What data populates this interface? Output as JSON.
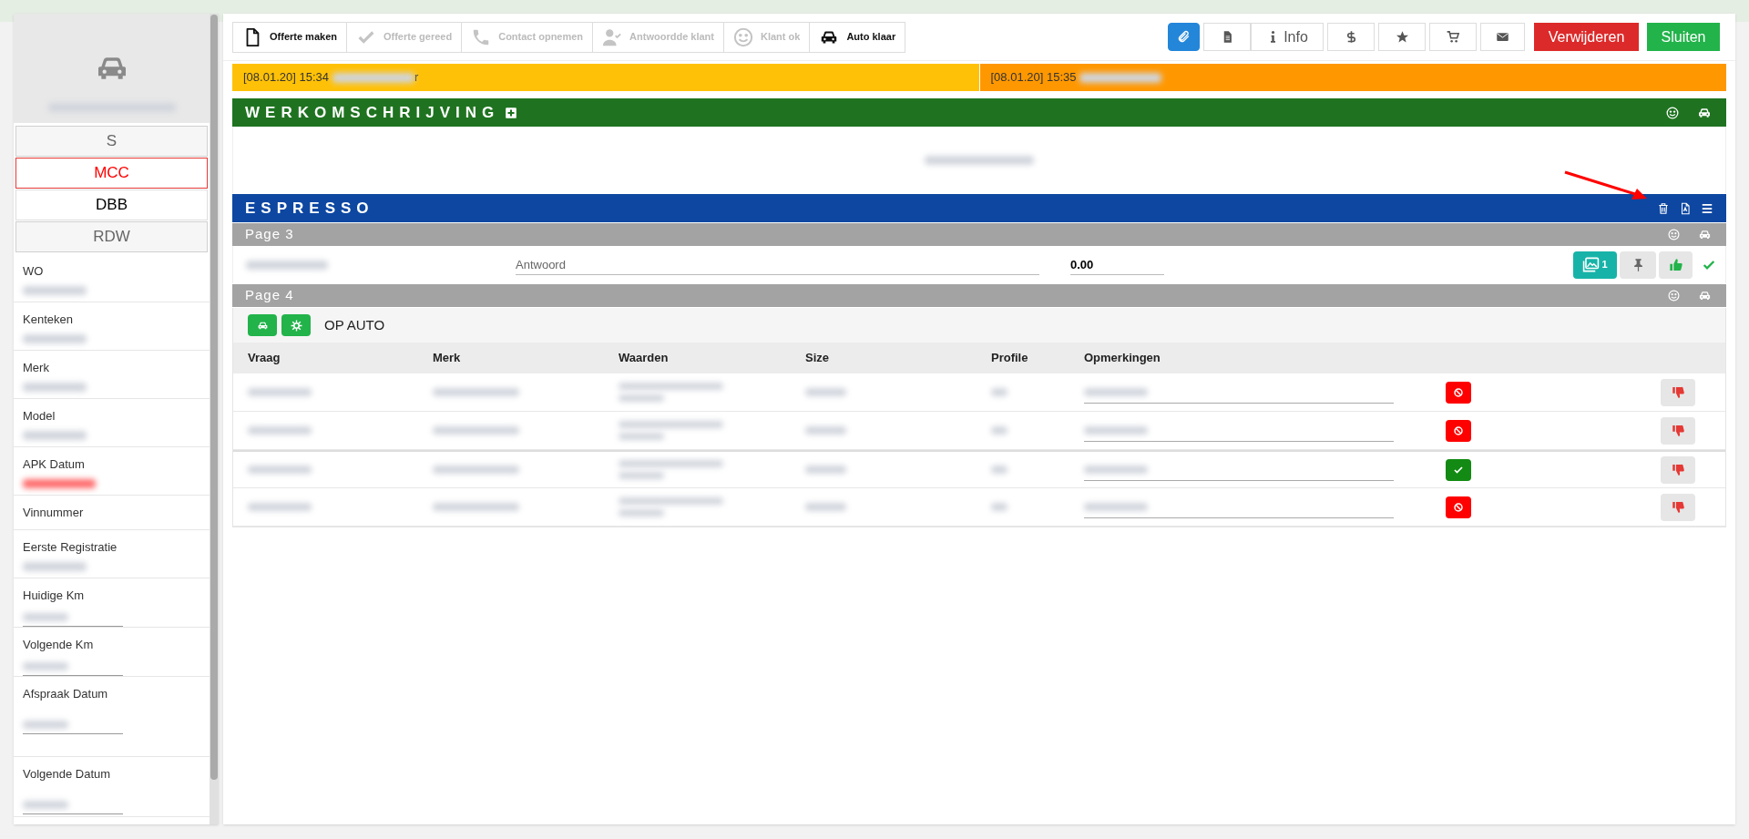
{
  "steps": [
    {
      "label": "Offerte maken",
      "active": true
    },
    {
      "label": "Offerte gereed",
      "active": false
    },
    {
      "label": "Contact opnemen",
      "active": false
    },
    {
      "label": "Antwoordde klant",
      "active": false
    },
    {
      "label": "Klant ok",
      "active": false
    },
    {
      "label": "Auto klaar",
      "active": true
    }
  ],
  "toolbar": [
    {
      "kind": "attach"
    },
    {
      "kind": "document"
    },
    {
      "kind": "info",
      "label": "Info"
    },
    {
      "kind": "dollar"
    },
    {
      "kind": "star"
    },
    {
      "kind": "cart"
    },
    {
      "kind": "mail"
    },
    {
      "kind": "delete",
      "label": "Verwijderen"
    },
    {
      "kind": "close",
      "label": "Sluiten"
    }
  ],
  "sidebar": {
    "tabs": [
      {
        "label": "S",
        "selected": false,
        "disabled": true
      },
      {
        "label": "MCC",
        "selected": true,
        "disabled": false
      },
      {
        "label": "DBB",
        "selected": false,
        "disabled": false
      },
      {
        "label": "RDW",
        "selected": false,
        "disabled": true
      }
    ],
    "fields": [
      {
        "label": "WO",
        "kind": "text"
      },
      {
        "label": "Kenteken",
        "kind": "text"
      },
      {
        "label": "Merk",
        "kind": "text"
      },
      {
        "label": "Model",
        "kind": "text"
      },
      {
        "label": "APK Datum",
        "kind": "warning"
      },
      {
        "label": "Vinnummer",
        "kind": "empty"
      },
      {
        "label": "Eerste Registratie",
        "kind": "text"
      },
      {
        "label": "Huidige Km",
        "kind": "input"
      },
      {
        "label": "Volgende Km",
        "kind": "input"
      },
      {
        "label": "Afspraak Datum",
        "kind": "date"
      },
      {
        "label": "Volgende Datum",
        "kind": "date"
      }
    ]
  },
  "notifications": [
    {
      "time": "[08.01.20] 15:34",
      "tail": "r",
      "color": "#ffc107"
    },
    {
      "time": "[08.01.20] 15:35",
      "color": "#ff9800"
    }
  ],
  "work_description": {
    "title": "WERKOMSCHRIJVING"
  },
  "checklist": {
    "title": "ESPRESSO",
    "pages": [
      {
        "title": "Page 3",
        "kind": "questions",
        "rows": [
          {
            "placeholder": "Antwoord",
            "value": "0.00",
            "photo_count": "1",
            "approved": true
          }
        ]
      },
      {
        "title": "Page 4",
        "kind": "table",
        "group": "OP AUTO",
        "columns": [
          "Vraag",
          "Merk",
          "Waarden",
          "Size",
          "Profile",
          "Opmerkingen"
        ],
        "rows": [
          {
            "ok": false
          },
          {
            "ok": false
          },
          {
            "ok": true
          },
          {
            "ok": false
          }
        ]
      }
    ]
  }
}
